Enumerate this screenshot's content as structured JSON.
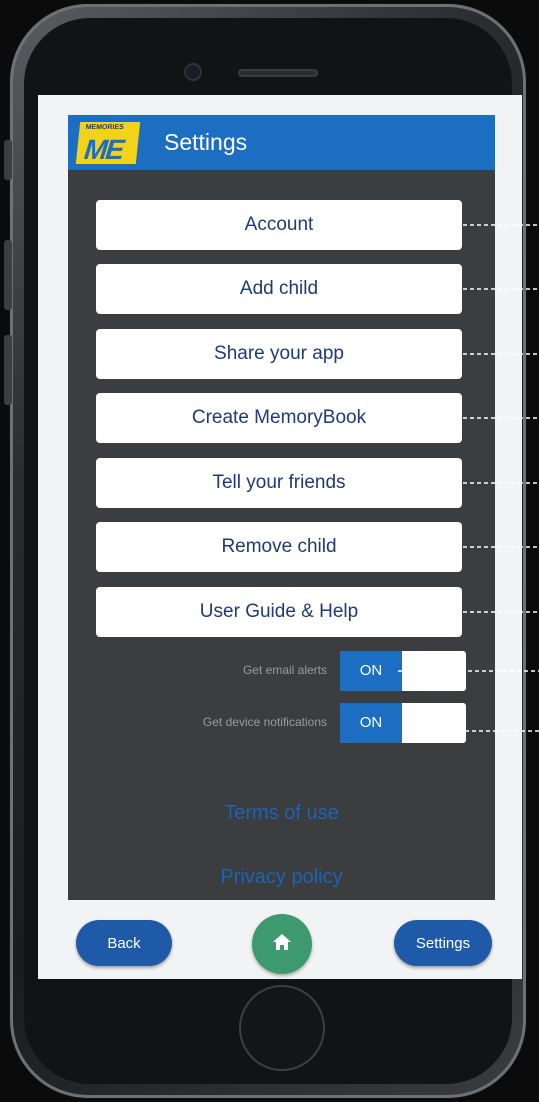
{
  "header": {
    "title": "Settings",
    "logo_text": "ME",
    "logo_small": "MEMORIES"
  },
  "menu": {
    "items": [
      {
        "label": "Account"
      },
      {
        "label": "Add child"
      },
      {
        "label": "Share your app"
      },
      {
        "label": "Create MemoryBook"
      },
      {
        "label": "Tell your friends"
      },
      {
        "label": "Remove child"
      },
      {
        "label": "User Guide & Help"
      }
    ]
  },
  "toggles": [
    {
      "label": "Get email alerts",
      "state": "ON"
    },
    {
      "label": "Get device notifications",
      "state": "ON"
    }
  ],
  "links": {
    "terms": "Terms of use",
    "privacy": "Privacy policy"
  },
  "bottom_bar": {
    "back_label": "Back",
    "settings_label": "Settings",
    "home_icon": "home-icon"
  },
  "colors": {
    "header_blue": "#1c6ec2",
    "content_bg": "#3c3d3f",
    "home_green": "#3d9a6f",
    "logo_yellow": "#f3d21a"
  }
}
